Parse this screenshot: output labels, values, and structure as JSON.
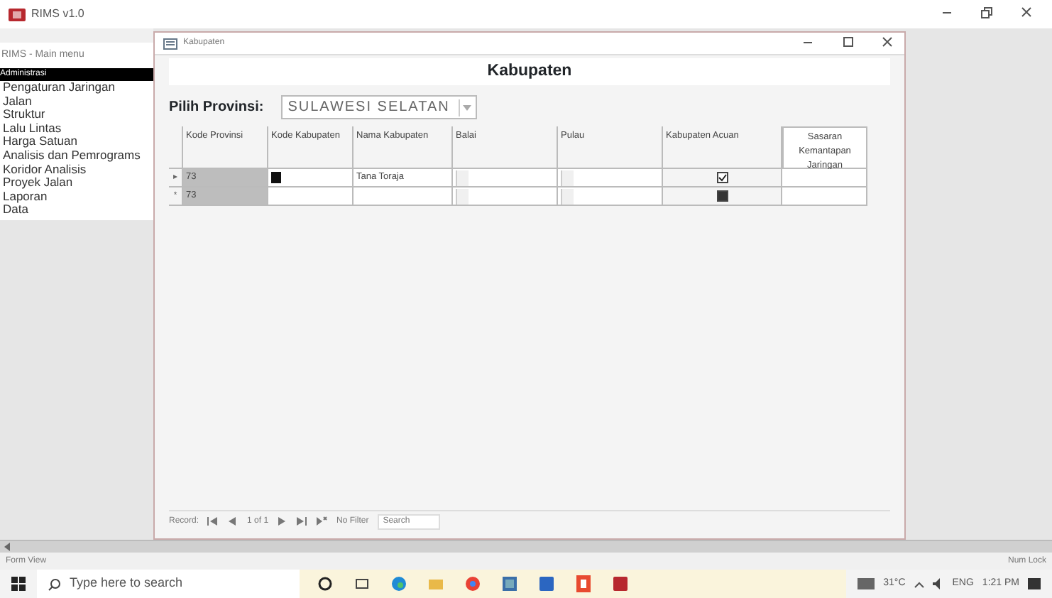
{
  "app_window": {
    "title": "RIMS v1.0"
  },
  "sidebar": {
    "title": "RIMS - Main menu",
    "items": [
      {
        "label": "Administrasi",
        "selected": true
      },
      {
        "label": "Pengaturan Jaringan",
        "selected": false
      },
      {
        "label": "Jalan",
        "selected": false
      },
      {
        "label": "Struktur",
        "selected": false
      },
      {
        "label": "Lalu Lintas",
        "selected": false
      },
      {
        "label": "Harga Satuan",
        "selected": false
      },
      {
        "label": "Analisis dan Pemrograms",
        "selected": false
      },
      {
        "label": "Koridor Analisis",
        "selected": false
      },
      {
        "label": "Proyek Jalan",
        "selected": false
      },
      {
        "label": "Laporan",
        "selected": false
      },
      {
        "label": "Data",
        "selected": false
      }
    ]
  },
  "form_window": {
    "title": "Kabupaten",
    "heading": "Kabupaten",
    "province_label": "Pilih Provinsi:",
    "province_value": "SULAWESI SELATAN",
    "columns": [
      "Kode Provinsi",
      "Kode Kabupaten",
      "Nama Kabupaten",
      "Balai",
      "Pulau",
      "Kabupaten Acuan",
      "Sasaran Kemantapan Jaringan"
    ],
    "rows": [
      {
        "selector": "▸",
        "kode_provinsi": "73",
        "kode_kabupaten": "",
        "nama_kabupaten": "Tana Toraja",
        "acuan_checked": true,
        "current": true
      },
      {
        "selector": "*",
        "kode_provinsi": "73",
        "kode_kabupaten": "",
        "nama_kabupaten": "",
        "acuan_checked": false,
        "current": false
      }
    ],
    "navigator": {
      "label": "Record:",
      "position": "1 of 1",
      "filter": "No Filter",
      "search": "Search"
    }
  },
  "status_bar": {
    "left": "Form View",
    "right": "Num Lock"
  },
  "taskbar": {
    "search_placeholder": "Type here to search",
    "weather": "31°C",
    "language": "ENG",
    "time": "1:21 PM"
  }
}
